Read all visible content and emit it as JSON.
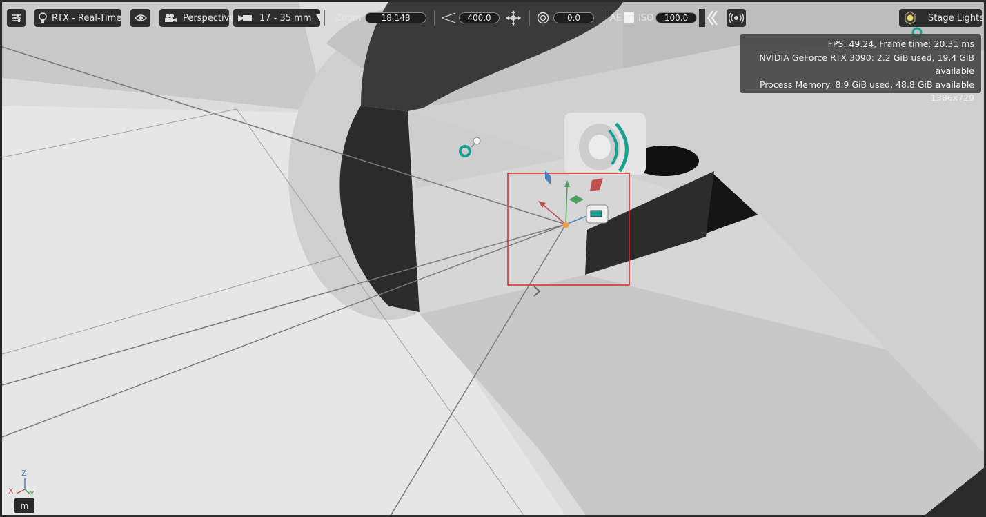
{
  "toolbar": {
    "renderer_label": "RTX - Real-Time",
    "camera_label": "Perspective",
    "lens_label": "17 - 35 mm",
    "zoom_label": "Zoom",
    "zoom_value": "18.148",
    "focal_value": "400.0",
    "exposure_value": "0.0",
    "ae_label": "AE",
    "iso_label": "ISO",
    "iso_value": "100.0",
    "stage_lights_label": "Stage Lights"
  },
  "stats": {
    "fps_line": "FPS: 49.24, Frame time: 20.31 ms",
    "gpu_line": "NVIDIA GeForce RTX 3090: 2.2 GiB used, 19.4 GiB available",
    "memory_line": "Process Memory: 8.9 GiB used, 48.8 GiB available",
    "resolution": "1386x720"
  },
  "axes": {
    "z": "Z",
    "x": "X",
    "y": "Y"
  },
  "unit_badge": "m",
  "colors": {
    "selection_box": "#e02424",
    "gizmo_x": "#c05050",
    "gizmo_y": "#4fa060",
    "gizmo_z": "#4a7fc0",
    "light_teal": "#1aa090",
    "origin": "#f0a040"
  }
}
